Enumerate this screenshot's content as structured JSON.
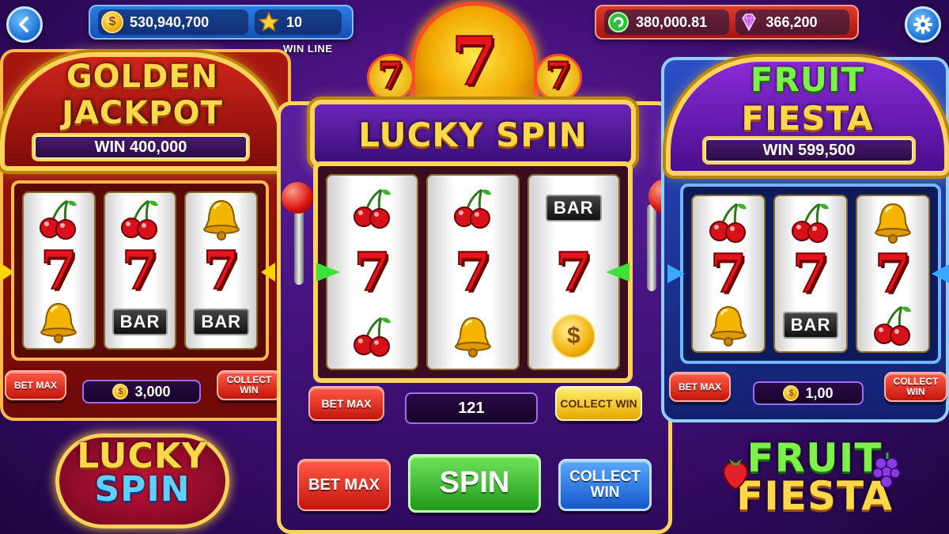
{
  "hud": {
    "back_icon": "chevron-left-icon",
    "settings_icon": "gear-icon",
    "coins": "530,940,700",
    "stars": "10",
    "win_line_label": "WIN LINE",
    "cash": "380,000.81",
    "gems": "366,200"
  },
  "left_machine": {
    "title_line1": "GOLDEN",
    "title_line2": "JACKPOT",
    "win_text": "WIN 400,000",
    "reels": [
      [
        "cherry",
        "seven",
        "bell"
      ],
      [
        "cherry",
        "seven",
        "bar"
      ],
      [
        "bell",
        "seven",
        "bar"
      ]
    ],
    "bet_max": "BET MAX",
    "collect_win": "COLLECT WIN",
    "bet_value": "3,000",
    "logo_line1": "LUCKY",
    "logo_line2": "SPIN"
  },
  "center_machine": {
    "top_seven": "7",
    "title": "LUCKY SPIN",
    "reels": [
      [
        "cherry",
        "seven",
        "cherry"
      ],
      [
        "cherry",
        "seven",
        "bell"
      ],
      [
        "bar",
        "seven",
        "coin"
      ]
    ],
    "bet_max": "BET MAX",
    "collect_win": "COLLECT WIN",
    "counter": "121",
    "bottom_bet_max": "BET MAX",
    "spin": "SPIN",
    "bottom_collect_win": "COLLECT WIN"
  },
  "right_machine": {
    "title_line1": "FRUIT",
    "title_line2": "FIESTA",
    "win_text": "WIN 599,500",
    "reels": [
      [
        "cherry",
        "seven",
        "bell"
      ],
      [
        "cherry",
        "seven",
        "bar"
      ],
      [
        "bell",
        "seven",
        "cherry"
      ]
    ],
    "bet_max": "BET MAX",
    "collect_win": "COLLECT WIN",
    "bet_value": "1,00",
    "logo_line1": "FRUIT",
    "logo_line2": "FIESTA"
  },
  "symbols": {
    "seven": "7",
    "bar": "BAR",
    "coin": "$"
  },
  "colors": {
    "gold": "#ffd35a",
    "red": "#d8120a",
    "purple": "#4a1a70",
    "blue": "#1650b4"
  }
}
